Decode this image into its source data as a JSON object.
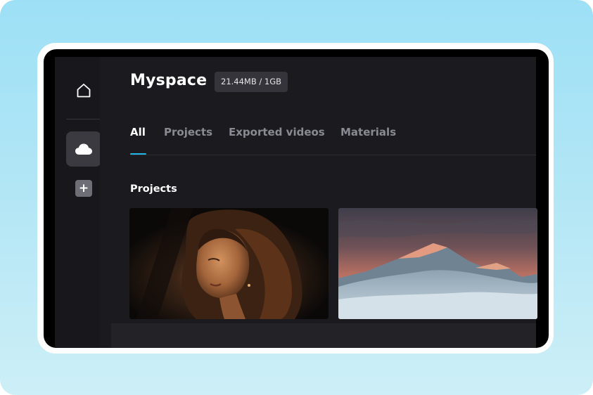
{
  "sidebar": {
    "home_icon": "home-icon",
    "cloud_icon": "cloud-icon",
    "add_label": "+"
  },
  "header": {
    "title": "Myspace",
    "storage": "21.44MB / 1GB"
  },
  "tabs": [
    {
      "label": "All",
      "active": true
    },
    {
      "label": "Projects",
      "active": false
    },
    {
      "label": "Exported videos",
      "active": false
    },
    {
      "label": "Materials",
      "active": false
    }
  ],
  "section": {
    "heading": "Projects"
  },
  "colors": {
    "accent": "#22b5e8",
    "background": "#1a1a1f",
    "sidebar": "#18181c"
  }
}
